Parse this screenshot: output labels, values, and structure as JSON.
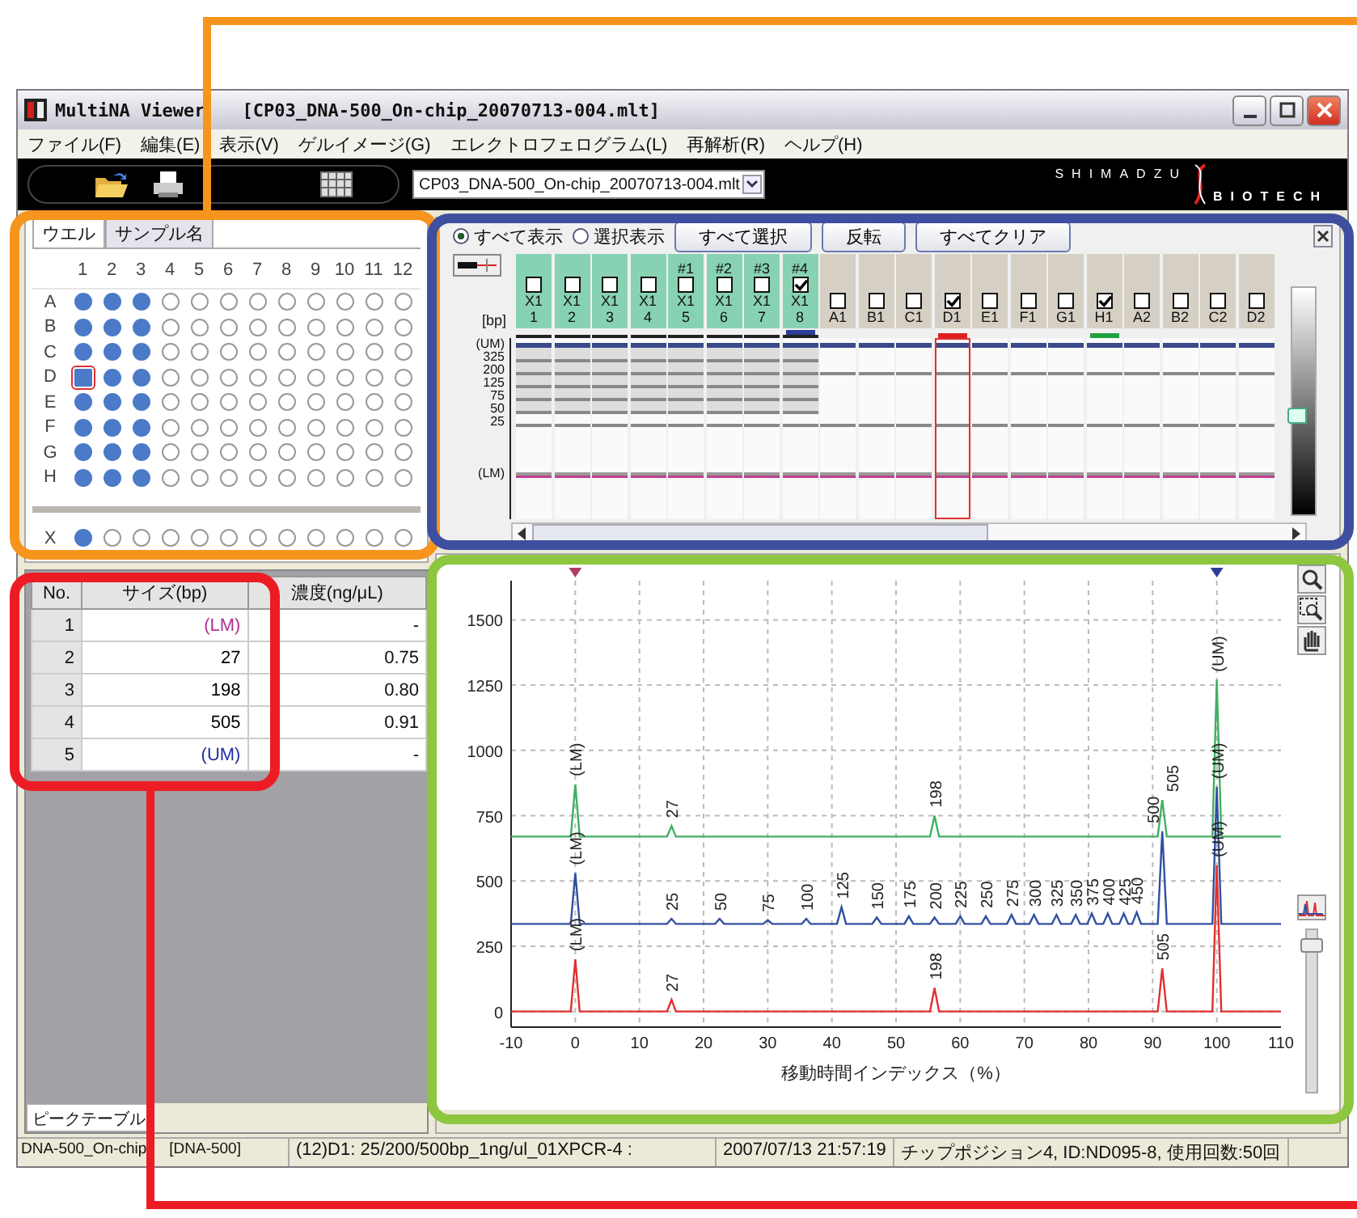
{
  "window": {
    "title": "MultiNA Viewer",
    "document": "[CP03_DNA-500_On-chip_20070713-004.mlt]"
  },
  "menu": [
    "ファイル(F)",
    "編集(E)",
    "表示(V)",
    "ゲルイメージ(G)",
    "エレクトロフェログラム(L)",
    "再解析(R)",
    "ヘルプ(H)"
  ],
  "toolbar": {
    "file_select": "CP03_DNA-500_On-chip_20070713-004.mlt",
    "logo": {
      "top": "SHIMADZU",
      "bottom": "BIOTECH"
    }
  },
  "plate": {
    "tabs": [
      {
        "label": "ウエル",
        "selected": true
      },
      {
        "label": "サンプル名",
        "selected": false
      }
    ],
    "columns": [
      "1",
      "2",
      "3",
      "4",
      "5",
      "6",
      "7",
      "8",
      "9",
      "10",
      "11",
      "12"
    ],
    "rows": [
      {
        "label": "A",
        "filled": [
          true,
          true,
          true,
          false,
          false,
          false,
          false,
          false,
          false,
          false,
          false,
          false
        ],
        "selected": [
          false,
          false,
          false,
          false,
          false,
          false,
          false,
          false,
          false,
          false,
          false,
          false
        ]
      },
      {
        "label": "B",
        "filled": [
          true,
          true,
          true,
          false,
          false,
          false,
          false,
          false,
          false,
          false,
          false,
          false
        ],
        "selected": [
          false,
          false,
          false,
          false,
          false,
          false,
          false,
          false,
          false,
          false,
          false,
          false
        ]
      },
      {
        "label": "C",
        "filled": [
          true,
          true,
          true,
          false,
          false,
          false,
          false,
          false,
          false,
          false,
          false,
          false
        ],
        "selected": [
          false,
          false,
          false,
          false,
          false,
          false,
          false,
          false,
          false,
          false,
          false,
          false
        ]
      },
      {
        "label": "D",
        "filled": [
          true,
          true,
          true,
          false,
          false,
          false,
          false,
          false,
          false,
          false,
          false,
          false
        ],
        "selected": [
          true,
          false,
          false,
          false,
          false,
          false,
          false,
          false,
          false,
          false,
          false,
          false
        ]
      },
      {
        "label": "E",
        "filled": [
          true,
          true,
          true,
          false,
          false,
          false,
          false,
          false,
          false,
          false,
          false,
          false
        ],
        "selected": [
          false,
          false,
          false,
          false,
          false,
          false,
          false,
          false,
          false,
          false,
          false,
          false
        ]
      },
      {
        "label": "F",
        "filled": [
          true,
          true,
          true,
          false,
          false,
          false,
          false,
          false,
          false,
          false,
          false,
          false
        ],
        "selected": [
          false,
          false,
          false,
          false,
          false,
          false,
          false,
          false,
          false,
          false,
          false,
          false
        ]
      },
      {
        "label": "G",
        "filled": [
          true,
          true,
          true,
          false,
          false,
          false,
          false,
          false,
          false,
          false,
          false,
          false
        ],
        "selected": [
          false,
          false,
          false,
          false,
          false,
          false,
          false,
          false,
          false,
          false,
          false,
          false
        ]
      },
      {
        "label": "H",
        "filled": [
          true,
          true,
          true,
          false,
          false,
          false,
          false,
          false,
          false,
          false,
          false,
          false
        ],
        "selected": [
          false,
          false,
          false,
          false,
          false,
          false,
          false,
          false,
          false,
          false,
          false,
          false
        ]
      }
    ],
    "extra_rows": [
      {
        "label": "X",
        "filled": [
          true,
          false,
          false,
          false,
          false,
          false,
          false,
          false,
          false,
          false,
          false,
          false
        ],
        "selected": [
          false,
          false,
          false,
          false,
          false,
          false,
          false,
          false,
          false,
          false,
          false,
          false
        ]
      }
    ]
  },
  "peak_table": {
    "columns": [
      "No.",
      "サイズ(bp)",
      "濃度(ng/μL)"
    ],
    "rows": [
      {
        "no": "1",
        "size": "(LM)",
        "concentration": "-",
        "color": "#b03090"
      },
      {
        "no": "2",
        "size": "27",
        "concentration": "0.75",
        "color": "#000000"
      },
      {
        "no": "3",
        "size": "198",
        "concentration": "0.80",
        "color": "#000000"
      },
      {
        "no": "4",
        "size": "505",
        "concentration": "0.91",
        "color": "#000000"
      },
      {
        "no": "5",
        "size": "(UM)",
        "concentration": "-",
        "color": "#2030a0"
      }
    ],
    "tab": "ピークテーブル"
  },
  "gel": {
    "display_modes": [
      {
        "label": "すべて表示",
        "selected": true
      },
      {
        "label": "選択表示",
        "selected": false
      }
    ],
    "buttons": [
      "すべて選択",
      "反転",
      "すべてクリア"
    ],
    "unit": "[bp]",
    "size_labels": [
      "(UM)",
      "325",
      "200",
      "125",
      "75",
      "50",
      "25",
      "(LM)"
    ],
    "contrast_slider": {
      "level": 0.47
    },
    "lanes": [
      {
        "name": "X1",
        "number": "1",
        "kind": "ladder",
        "checked": false,
        "selected": false
      },
      {
        "name": "X1",
        "number": "2",
        "kind": "ladder",
        "checked": false,
        "selected": false
      },
      {
        "name": "X1",
        "number": "3",
        "kind": "ladder",
        "checked": false,
        "selected": false
      },
      {
        "name": "X1",
        "number": "4",
        "kind": "ladder",
        "checked": false,
        "selected": false
      },
      {
        "tag": "#1",
        "name": "X1",
        "number": "5",
        "kind": "ladder",
        "checked": false,
        "selected": false
      },
      {
        "tag": "#2",
        "name": "X1",
        "number": "6",
        "kind": "ladder",
        "checked": false,
        "selected": false
      },
      {
        "tag": "#3",
        "name": "X1",
        "number": "7",
        "kind": "ladder",
        "checked": false,
        "selected": false
      },
      {
        "tag": "#4",
        "name": "X1",
        "number": "8",
        "kind": "ladder",
        "checked": true,
        "selected": false,
        "color": "#2c3e9a"
      },
      {
        "name": "A1",
        "kind": "sample",
        "checked": false,
        "selected": false
      },
      {
        "name": "B1",
        "kind": "sample",
        "checked": false,
        "selected": false
      },
      {
        "name": "C1",
        "kind": "sample",
        "checked": false,
        "selected": false
      },
      {
        "name": "D1",
        "kind": "sample",
        "checked": true,
        "selected": true,
        "color": "#e02020"
      },
      {
        "name": "E1",
        "kind": "sample",
        "checked": false,
        "selected": false
      },
      {
        "name": "F1",
        "kind": "sample",
        "checked": false,
        "selected": false
      },
      {
        "name": "G1",
        "kind": "sample",
        "checked": false,
        "selected": false
      },
      {
        "name": "H1",
        "kind": "sample",
        "checked": true,
        "selected": false,
        "color": "#20a040"
      },
      {
        "name": "A2",
        "kind": "sample",
        "checked": false,
        "selected": false
      },
      {
        "name": "B2",
        "kind": "sample",
        "checked": false,
        "selected": false
      },
      {
        "name": "C2",
        "kind": "sample",
        "checked": false,
        "selected": false
      },
      {
        "name": "D2",
        "kind": "sample",
        "checked": false,
        "selected": false
      }
    ]
  },
  "chart": {
    "zoom_slider": {
      "level": 0.95
    },
    "chart_data": {
      "type": "line",
      "grid": true,
      "xlabel": "移動時間インデックス（%）",
      "xlim": [
        -10,
        110
      ],
      "ylim": [
        -60,
        1650
      ],
      "xticks": [
        -10,
        0,
        10,
        20,
        30,
        40,
        50,
        60,
        70,
        80,
        90,
        100,
        110
      ],
      "yticks": [
        0,
        250,
        500,
        750,
        1000,
        1250,
        1500
      ],
      "x": [
        -10,
        -0.7,
        0,
        0.7,
        14.3,
        15,
        15.7,
        21.8,
        22.5,
        23.2,
        29.3,
        30,
        30.7,
        35.3,
        36,
        36.7,
        40.8,
        41.5,
        42.2,
        46.3,
        47,
        47.7,
        51.3,
        52,
        52.7,
        55.3,
        56,
        56.7,
        59.3,
        60,
        60.7,
        63.3,
        64,
        64.7,
        67.3,
        68,
        68.7,
        70.8,
        71.5,
        72.2,
        74.3,
        75,
        75.7,
        77.3,
        78,
        78.7,
        79.8,
        80.5,
        81.2,
        82.3,
        83,
        83.7,
        84.8,
        85.5,
        86.2,
        86.8,
        87.5,
        88.2,
        90.8,
        91.5,
        92.2,
        99.3,
        100,
        100.7,
        110
      ],
      "series": [
        {
          "color": "#40b060",
          "values": [
            670,
            670,
            870,
            670,
            670,
            710,
            670,
            670,
            670,
            670,
            670,
            670,
            670,
            670,
            670,
            670,
            670,
            670,
            670,
            670,
            670,
            670,
            670,
            670,
            670,
            670,
            750,
            670,
            670,
            670,
            670,
            670,
            670,
            670,
            670,
            670,
            670,
            670,
            670,
            670,
            670,
            670,
            670,
            670,
            670,
            670,
            670,
            670,
            670,
            670,
            670,
            670,
            670,
            670,
            670,
            670,
            670,
            670,
            670,
            810,
            670,
            670,
            1270,
            670,
            670
          ]
        },
        {
          "color": "#3050a0",
          "values": [
            335,
            335,
            530,
            335,
            335,
            355,
            335,
            335,
            355,
            335,
            335,
            350,
            335,
            335,
            355,
            335,
            335,
            400,
            335,
            335,
            360,
            335,
            335,
            365,
            335,
            335,
            360,
            335,
            335,
            365,
            335,
            335,
            365,
            335,
            335,
            370,
            335,
            335,
            370,
            335,
            335,
            370,
            335,
            335,
            370,
            335,
            335,
            375,
            335,
            335,
            375,
            335,
            335,
            375,
            335,
            335,
            380,
            335,
            335,
            690,
            335,
            335,
            860,
            335,
            335
          ]
        },
        {
          "color": "#e03030",
          "values": [
            0,
            0,
            200,
            0,
            0,
            45,
            0,
            0,
            0,
            0,
            0,
            0,
            0,
            0,
            0,
            0,
            0,
            0,
            0,
            0,
            0,
            0,
            0,
            0,
            0,
            0,
            90,
            0,
            0,
            0,
            0,
            0,
            0,
            0,
            0,
            0,
            0,
            0,
            0,
            0,
            0,
            0,
            0,
            0,
            0,
            0,
            0,
            0,
            0,
            0,
            0,
            0,
            0,
            0,
            0,
            0,
            0,
            0,
            0,
            165,
            0,
            0,
            560,
            0,
            0
          ]
        }
      ],
      "annotations": [
        {
          "x": 0,
          "y": 870,
          "text": "(LM)"
        },
        {
          "x": 15,
          "y": 710,
          "text": "27"
        },
        {
          "x": 56,
          "y": 750,
          "text": "198"
        },
        {
          "x": 91.5,
          "y": 810,
          "text": "505"
        },
        {
          "x": 100,
          "y": 1270,
          "text": "(UM)"
        },
        {
          "x": 0,
          "y": 530,
          "text": "(LM)"
        },
        {
          "x": 15,
          "y": 355,
          "text": "25"
        },
        {
          "x": 22.5,
          "y": 355,
          "text": "50"
        },
        {
          "x": 30,
          "y": 350,
          "text": "75"
        },
        {
          "x": 36,
          "y": 355,
          "text": "100"
        },
        {
          "x": 41.5,
          "y": 400,
          "text": "125"
        },
        {
          "x": 47,
          "y": 360,
          "text": "150"
        },
        {
          "x": 52,
          "y": 365,
          "text": "175"
        },
        {
          "x": 56,
          "y": 360,
          "text": "200"
        },
        {
          "x": 60,
          "y": 365,
          "text": "225"
        },
        {
          "x": 64,
          "y": 365,
          "text": "250"
        },
        {
          "x": 68,
          "y": 370,
          "text": "275"
        },
        {
          "x": 71.5,
          "y": 370,
          "text": "300"
        },
        {
          "x": 75,
          "y": 370,
          "text": "325"
        },
        {
          "x": 78,
          "y": 370,
          "text": "350"
        },
        {
          "x": 80.5,
          "y": 375,
          "text": "375"
        },
        {
          "x": 83,
          "y": 375,
          "text": "400"
        },
        {
          "x": 85.5,
          "y": 375,
          "text": "425"
        },
        {
          "x": 87.5,
          "y": 380,
          "text": "450"
        },
        {
          "x": 91.5,
          "y": 690,
          "text": "500"
        },
        {
          "x": 100,
          "y": 860,
          "text": "(UM)"
        },
        {
          "x": 0,
          "y": 200,
          "text": "(LM)"
        },
        {
          "x": 15,
          "y": 45,
          "text": "27"
        },
        {
          "x": 56,
          "y": 90,
          "text": "198"
        },
        {
          "x": 91.5,
          "y": 165,
          "text": "505"
        },
        {
          "x": 100,
          "y": 560,
          "text": "(UM)"
        }
      ]
    }
  },
  "status_bar": [
    "DNA-500_On-chip",
    "[DNA-500]",
    "(12)D1: 25/200/500bp_1ng/ul_01XPCR-4 :",
    "2007/07/13 21:57:19",
    "チップポジション4, ID:ND095-8, 使用回数:50回"
  ]
}
